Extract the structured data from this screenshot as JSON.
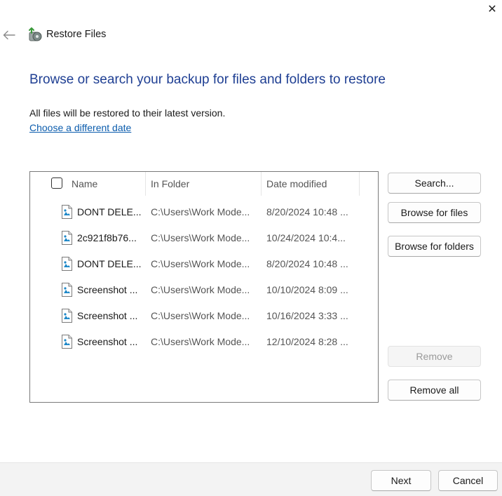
{
  "window": {
    "title": "Restore Files",
    "close_glyph": "✕",
    "back_glyph": "←"
  },
  "main": {
    "headline": "Browse or search your backup for files and folders to restore",
    "info": "All files will be restored to their latest version.",
    "date_link": "Choose a different date"
  },
  "file_list": {
    "columns": [
      "Name",
      "In Folder",
      "Date modified"
    ],
    "rows": [
      {
        "name": "DONT DELE...",
        "folder": "C:\\Users\\Work Mode...",
        "date": "8/20/2024 10:48 ..."
      },
      {
        "name": "2c921f8b76...",
        "folder": "C:\\Users\\Work Mode...",
        "date": "10/24/2024 10:4..."
      },
      {
        "name": "DONT DELE...",
        "folder": "C:\\Users\\Work Mode...",
        "date": "8/20/2024 10:48 ..."
      },
      {
        "name": "Screenshot ...",
        "folder": "C:\\Users\\Work Mode...",
        "date": "10/10/2024 8:09 ..."
      },
      {
        "name": "Screenshot ...",
        "folder": "C:\\Users\\Work Mode...",
        "date": "10/16/2024 3:33 ..."
      },
      {
        "name": "Screenshot ...",
        "folder": "C:\\Users\\Work Mode...",
        "date": "12/10/2024 8:28 ..."
      }
    ]
  },
  "side_buttons": {
    "search": "Search...",
    "browse_files": "Browse for files",
    "browse_folders": "Browse for folders",
    "remove": "Remove",
    "remove_all": "Remove all"
  },
  "footer": {
    "next": "Next",
    "cancel": "Cancel"
  },
  "icons": {
    "close": "close-icon",
    "back": "back-arrow-icon",
    "app": "backup-restore-icon",
    "file": "image-file-icon"
  },
  "colors": {
    "headline": "#1f3f93",
    "link": "#0b5cad",
    "footer_bg": "#f3f3f3"
  }
}
